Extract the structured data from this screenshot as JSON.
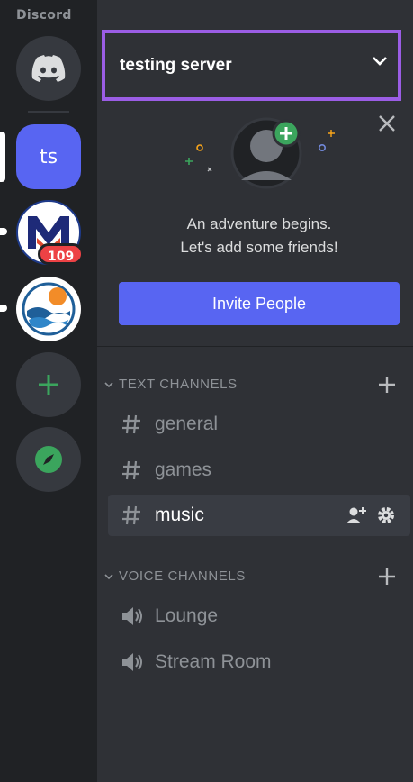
{
  "app": {
    "brand": "Discord"
  },
  "servers": [
    {
      "name": "discord-home",
      "label": ""
    },
    {
      "name": "testing-server",
      "label": "ts"
    },
    {
      "name": "server-m",
      "label": "M",
      "badge": "109"
    },
    {
      "name": "server-landscape",
      "label": ""
    }
  ],
  "header": {
    "server_name": "testing server"
  },
  "hero": {
    "line1": "An adventure begins.",
    "line2": "Let's add some friends!",
    "invite_label": "Invite People"
  },
  "categories": {
    "text": "TEXT CHANNELS",
    "voice": "VOICE CHANNELS"
  },
  "text_channels": [
    "general",
    "games",
    "music"
  ],
  "voice_channels": [
    "Lounge",
    "Stream Room"
  ],
  "colors": {
    "accent": "#5865f2",
    "highlight_border": "#9b5de5",
    "badge": "#ed4245",
    "add_green": "#3ba55d"
  }
}
